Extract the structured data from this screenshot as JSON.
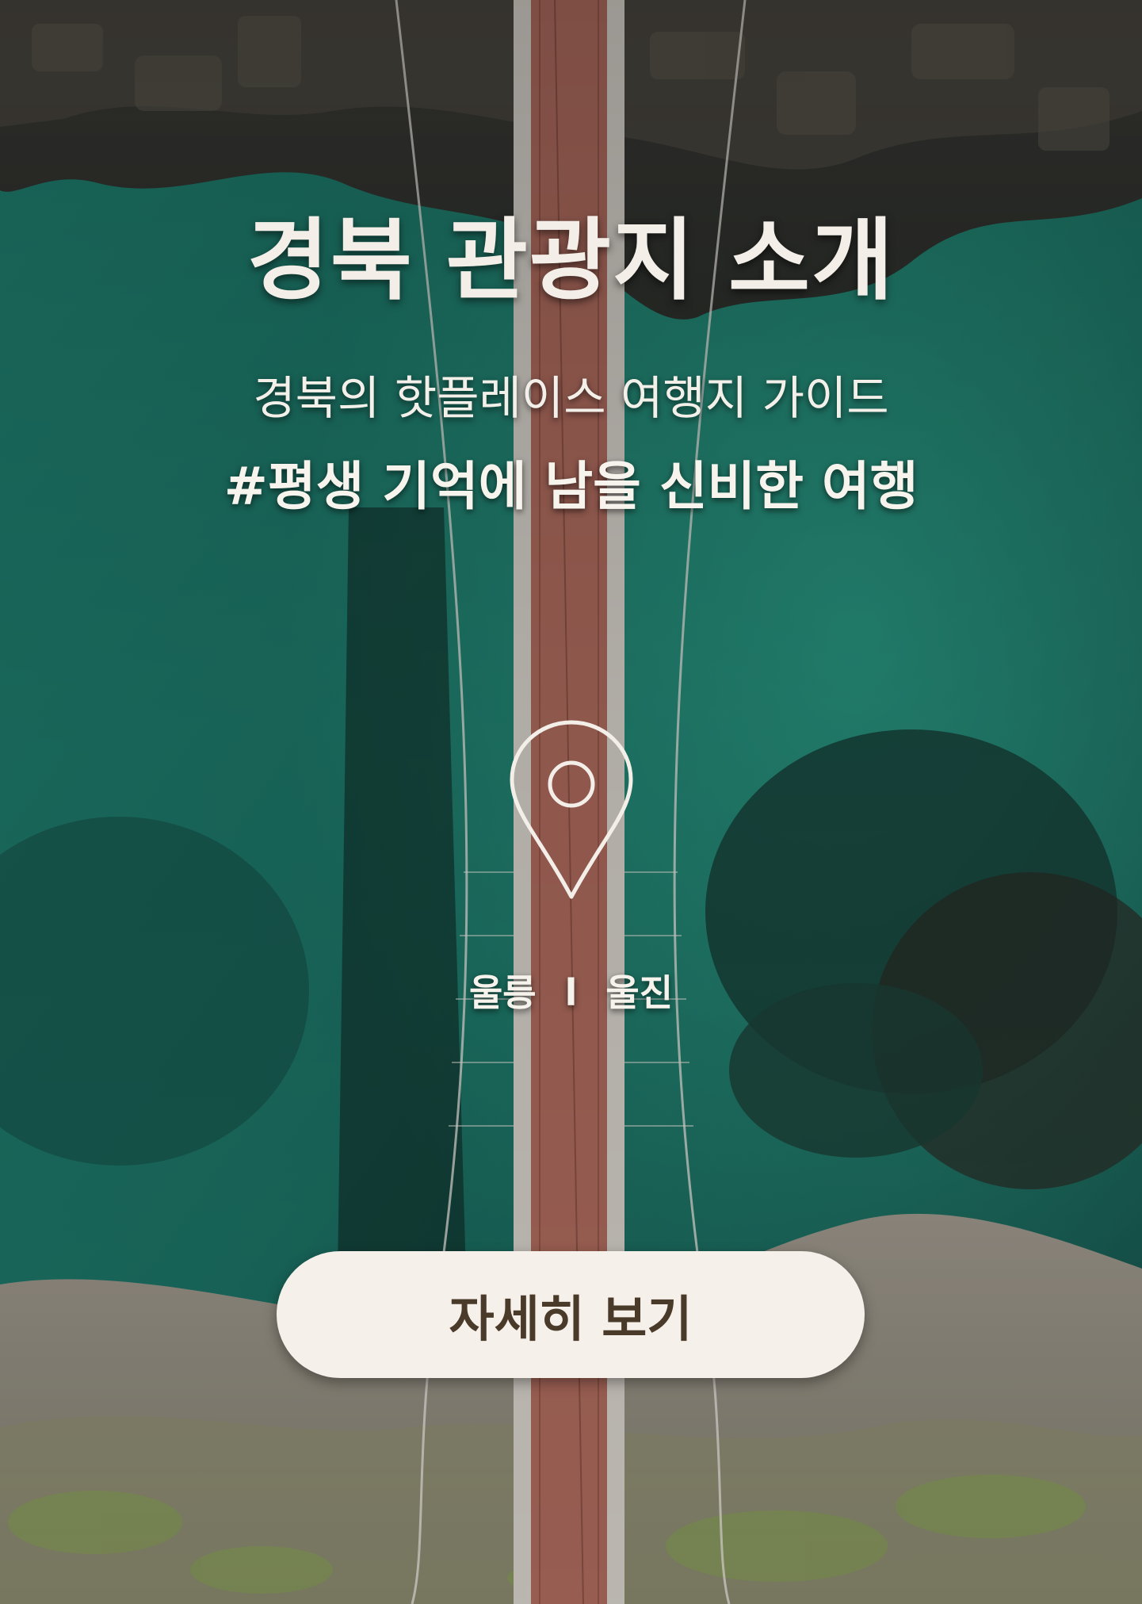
{
  "hero": {
    "title": "경북 관광지 소개",
    "subtitle": "경북의 핫플레이스 여행지 가이드",
    "hashtag": "#평생 기억에 남을 신비한 여행"
  },
  "locations": {
    "first": "울릉",
    "separator": "l",
    "second": "울진"
  },
  "cta": {
    "label": "자세히 보기"
  },
  "icons": {
    "pin": "map-pin-icon"
  },
  "colors": {
    "text": "#f3efe8",
    "button_bg": "#f5f0e9",
    "button_text": "#4a3a2a",
    "sea": "#1c7a6a",
    "bridge_deck": "#a9695a"
  }
}
